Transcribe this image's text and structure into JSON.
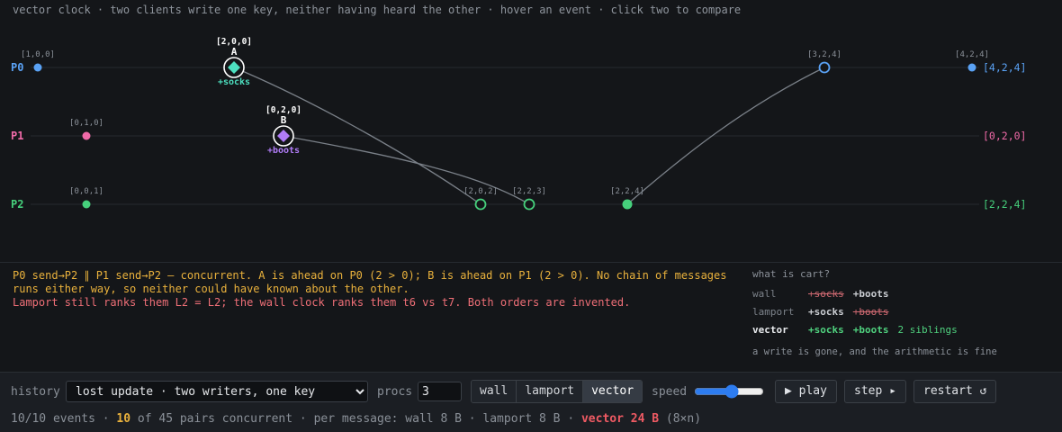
{
  "topbar": "vector clock · two clients write one key, neither having heard the other · hover an event · click two to compare",
  "colors": {
    "p0": "#5aa2f5",
    "p1": "#f06aa8",
    "p2": "#46d07c",
    "msg": "#7a8088",
    "socks": "#4de0c0",
    "boots": "#b07cf7"
  },
  "processes": [
    {
      "label": "P0",
      "final_vc": "[4,2,4]"
    },
    {
      "label": "P1",
      "final_vc": "[0,2,0]"
    },
    {
      "label": "P2",
      "final_vc": "[2,2,4]"
    }
  ],
  "events": [
    {
      "proc": 0,
      "vc": "[1,0,0]",
      "kind": "local"
    },
    {
      "proc": 0,
      "vc": "[2,0,0]",
      "kind": "write",
      "letter": "A",
      "write": "+socks"
    },
    {
      "proc": 0,
      "vc": "[3,2,4]",
      "kind": "recv"
    },
    {
      "proc": 0,
      "vc": "[4,2,4]",
      "kind": "local"
    },
    {
      "proc": 1,
      "vc": "[0,1,0]",
      "kind": "local"
    },
    {
      "proc": 1,
      "vc": "[0,2,0]",
      "kind": "write",
      "letter": "B",
      "write": "+boots"
    },
    {
      "proc": 2,
      "vc": "[0,0,1]",
      "kind": "local"
    },
    {
      "proc": 2,
      "vc": "[2,0,2]",
      "kind": "recv"
    },
    {
      "proc": 2,
      "vc": "[2,2,3]",
      "kind": "recv"
    },
    {
      "proc": 2,
      "vc": "[2,2,4]",
      "kind": "send"
    }
  ],
  "explanation": {
    "line1": "P0 send→P2 ∥ P1 send→P2 — concurrent. A is ahead on P0 (2 > 0); B is ahead on P1 (2 > 0). No chain of messages runs either way, so neither could have known about the other.",
    "line2": "Lamport still ranks them L2 = L2; the wall clock ranks them t6 vs t7. Both orders are invented."
  },
  "cart": {
    "question": "what is cart?",
    "rows": [
      {
        "label": "wall",
        "items": [
          "+socks",
          "+boots"
        ]
      },
      {
        "label": "lamport",
        "items": [
          "+socks",
          "+boots"
        ]
      },
      {
        "label": "vector",
        "items": [
          "+socks",
          "+boots"
        ],
        "extra": "2 siblings"
      }
    ],
    "note": "a write is gone, and the arithmetic is fine"
  },
  "controls": {
    "history_label": "history",
    "history_value": "lost update · two writers, one key",
    "procs_label": "procs",
    "procs_value": "3",
    "modes": [
      "wall",
      "lamport",
      "vector"
    ],
    "active_mode": "vector",
    "speed_label": "speed",
    "speed_value": 0.55,
    "play": "▶ play",
    "step": "step ▸",
    "restart": "restart ↺"
  },
  "status": {
    "events": "10/10 events",
    "concurrent_count": "10",
    "pairs_text": "of 45 pairs concurrent",
    "per_message": "per message: wall 8 B · lamport 8 B ·",
    "vector_size": "vector 24 B",
    "vector_note": "(8×n)"
  }
}
